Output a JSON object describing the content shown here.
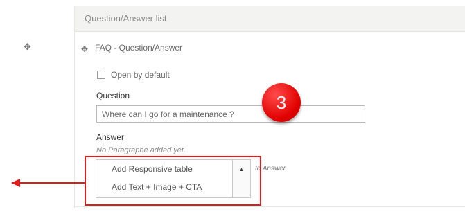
{
  "panel": {
    "header": "Question/Answer list"
  },
  "paragraph": {
    "drag_icon": "move-icon",
    "title": "FAQ - Question/Answer",
    "open_by_default": {
      "label": "Open by default",
      "checked": false
    }
  },
  "question": {
    "label": "Question",
    "value": "Where can I go for a maintenance ?"
  },
  "answer": {
    "label": "Answer",
    "empty_text": "No Paragraphe added yet.",
    "dropdown_items": [
      "Add Responsive table",
      "Add Text + Image + CTA"
    ],
    "to_label": "to",
    "target_label": "Answer"
  },
  "annotation": {
    "step": "3",
    "colors": {
      "badge": "#e10000",
      "highlight": "#e11a1a"
    }
  }
}
